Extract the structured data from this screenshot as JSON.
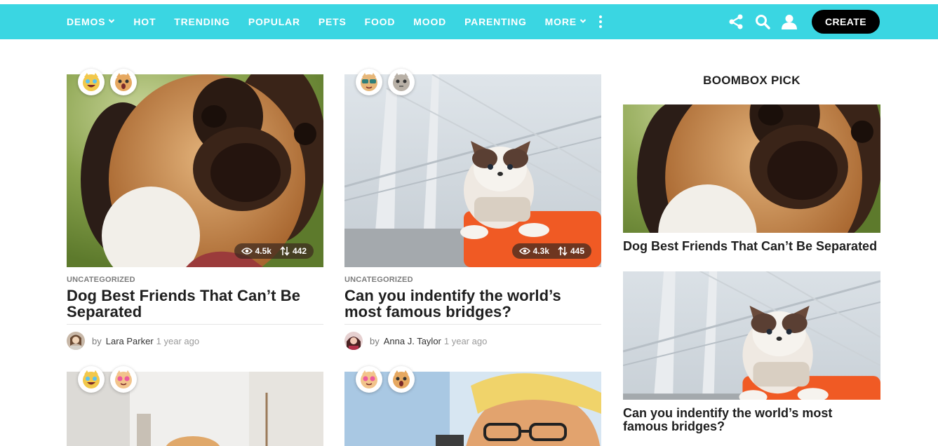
{
  "nav": {
    "items": [
      {
        "label": "DEMOS",
        "has_chevron": true
      },
      {
        "label": "HOT"
      },
      {
        "label": "TRENDING"
      },
      {
        "label": "POPULAR"
      },
      {
        "label": "PETS"
      },
      {
        "label": "FOOD"
      },
      {
        "label": "MOOD"
      },
      {
        "label": "PARENTING"
      },
      {
        "label": "MORE",
        "has_chevron": true
      }
    ],
    "create_label": "CREATE",
    "icons": [
      "share-icon",
      "search-icon",
      "user-icon"
    ],
    "bar_color": "#3ad6e2"
  },
  "posts": [
    {
      "category": "UNCATEGORIZED",
      "title": "Dog Best Friends That Can’t Be Separated",
      "by": "by",
      "author": "Lara Parker",
      "time": "1 year ago",
      "views": "4.5k",
      "votes": "442"
    },
    {
      "category": "UNCATEGORIZED",
      "title": "Can you indentify the world’s most famous bridges?",
      "by": "by",
      "author": "Anna J. Taylor",
      "time": "1 year ago",
      "views": "4.3k",
      "votes": "445"
    }
  ],
  "sidebar": {
    "heading": "BOOMBOX PICK",
    "items": [
      {
        "title": "Dog Best Friends That Can’t Be Separated"
      },
      {
        "title": "Can you indentify the world’s most famous bridges?"
      }
    ]
  }
}
